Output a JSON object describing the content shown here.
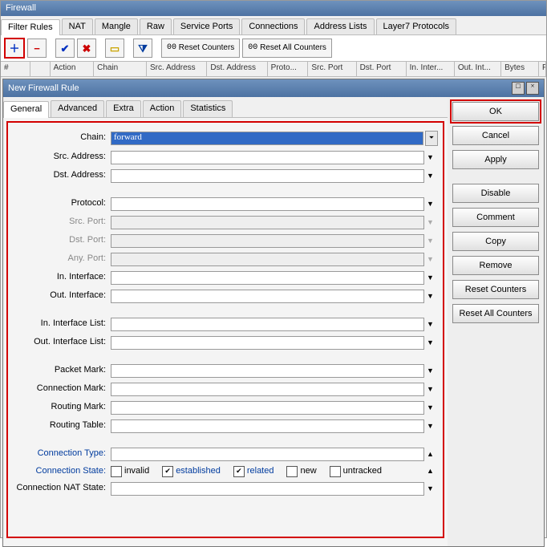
{
  "window_title": "Firewall",
  "tabs": [
    "Filter Rules",
    "NAT",
    "Mangle",
    "Raw",
    "Service Ports",
    "Connections",
    "Address Lists",
    "Layer7 Protocols"
  ],
  "toolbar": {
    "reset": "Reset Counters",
    "reset_all": "Reset All Counters",
    "cnt": "00"
  },
  "columns": [
    "#",
    "",
    "Action",
    "Chain",
    "Src. Address",
    "Dst. Address",
    "Proto...",
    "Src. Port",
    "Dst. Port",
    "In. Inter...",
    "Out. Int...",
    "Bytes",
    "Packets"
  ],
  "dialog": {
    "title": "New Firewall Rule",
    "tabs": [
      "General",
      "Advanced",
      "Extra",
      "Action",
      "Statistics"
    ],
    "fields": {
      "chain": "Chain:",
      "chain_val": "forward",
      "src_addr": "Src. Address:",
      "dst_addr": "Dst. Address:",
      "protocol": "Protocol:",
      "src_port": "Src. Port:",
      "dst_port": "Dst. Port:",
      "any_port": "Any. Port:",
      "in_if": "In. Interface:",
      "out_if": "Out. Interface:",
      "in_if_list": "In. Interface List:",
      "out_if_list": "Out. Interface List:",
      "pkt_mark": "Packet Mark:",
      "conn_mark": "Connection Mark:",
      "rout_mark": "Routing Mark:",
      "rout_tbl": "Routing Table:",
      "conn_type": "Connection Type:",
      "conn_state": "Connection State:",
      "conn_nat": "Connection NAT State:"
    },
    "conn_state_opts": {
      "invalid": "invalid",
      "established": "established",
      "related": "related",
      "new": "new",
      "untracked": "untracked"
    },
    "buttons": {
      "ok": "OK",
      "cancel": "Cancel",
      "apply": "Apply",
      "disable": "Disable",
      "comment": "Comment",
      "copy": "Copy",
      "remove": "Remove",
      "reset": "Reset Counters",
      "reset_all": "Reset All Counters"
    }
  }
}
